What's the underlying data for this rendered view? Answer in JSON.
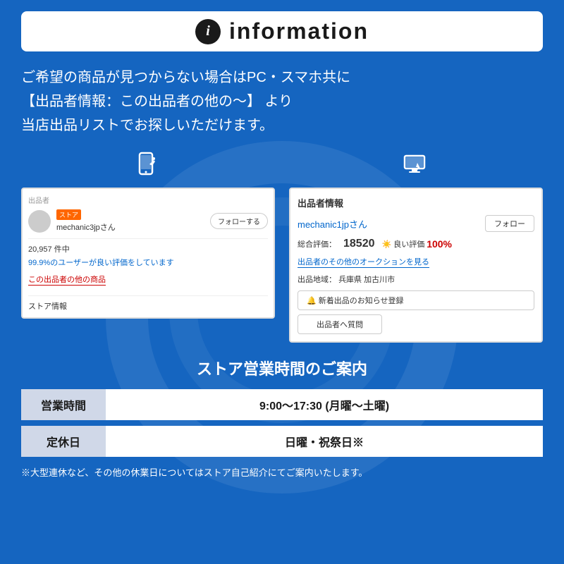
{
  "header": {
    "icon_text": "i",
    "title": "information"
  },
  "main_text": {
    "line1": "ご希望の商品が見つからない場合はPC・スマホ共に",
    "line2": "【出品者情報：この出品者の他の〜】 より",
    "line3": "当店出品リストでお探しいただけます。"
  },
  "mobile_screenshot": {
    "section_label": "出品者",
    "store_badge": "ストア",
    "seller_name": "mechanic3jpさん",
    "follow_btn": "フォローする",
    "count": "20,957 件中",
    "rating_text": "99.9%のユーザーが良い評価をしています",
    "other_link": "この出品者の他の商品",
    "store_info": "ストア情報"
  },
  "pc_screenshot": {
    "section_title": "出品者情報",
    "seller_name": "mechanic1jpさん",
    "follow_btn": "フォロー",
    "rating_label": "総合評価：",
    "rating_num": "18520",
    "good_label": "良い評価",
    "good_pct": "100%",
    "auction_link": "出品者のその他のオークションを見る",
    "location_label": "出品地域：",
    "location": "兵庫県 加古川市",
    "notification_btn": "🔔 新着出品のお知らせ登録",
    "question_btn": "出品者へ質問"
  },
  "store_hours": {
    "title": "ストア営業時間のご案内",
    "rows": [
      {
        "label": "営業時間",
        "value": "9:00〜17:30 (月曜〜土曜)"
      },
      {
        "label": "定休日",
        "value": "日曜・祝祭日※"
      }
    ],
    "note": "※大型連休など、その他の休業日についてはストア自己紹介にてご案内いたします。"
  }
}
